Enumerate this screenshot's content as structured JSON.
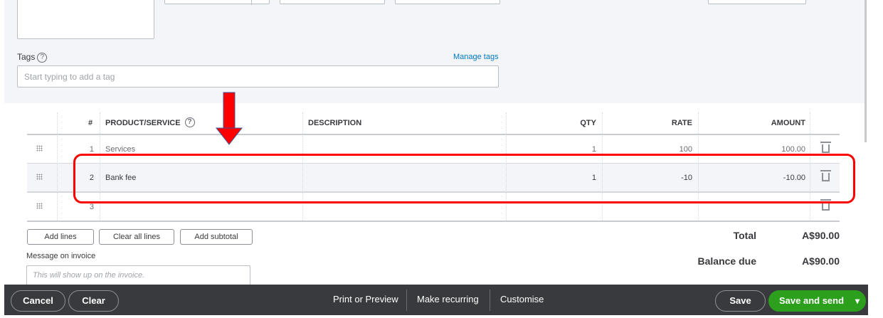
{
  "tags": {
    "label": "Tags",
    "help": "?",
    "manage_link": "Manage tags",
    "placeholder": "Start typing to add a tag"
  },
  "table": {
    "headers": {
      "num": "#",
      "product": "PRODUCT/SERVICE",
      "product_help": "?",
      "description": "DESCRIPTION",
      "qty": "QTY",
      "rate": "RATE",
      "amount": "AMOUNT"
    },
    "rows": [
      {
        "num": "1",
        "product": "Services",
        "description": "",
        "qty": "1",
        "rate": "100",
        "amount": "100.00"
      },
      {
        "num": "2",
        "product": "Bank fee",
        "description": "",
        "qty": "1",
        "rate": "-10",
        "amount": "-10.00"
      },
      {
        "num": "3",
        "product": "",
        "description": "",
        "qty": "",
        "rate": "",
        "amount": ""
      }
    ]
  },
  "actions": {
    "add_lines": "Add lines",
    "clear_all": "Clear all lines",
    "add_subtotal": "Add subtotal"
  },
  "message": {
    "label": "Message on invoice",
    "placeholder": "This will show up on the invoice."
  },
  "totals": {
    "total_label": "Total",
    "total_value": "A$90.00",
    "balance_label": "Balance due",
    "balance_value": "A$90.00"
  },
  "footer": {
    "cancel": "Cancel",
    "clear": "Clear",
    "print": "Print or Preview",
    "recurring": "Make recurring",
    "customise": "Customise",
    "save": "Save",
    "save_send": "Save and send",
    "dropdown": "▾"
  },
  "colors": {
    "accent_green": "#2ca01c",
    "annotation_red": "#ff0000",
    "footer_bg": "#393a3d"
  }
}
